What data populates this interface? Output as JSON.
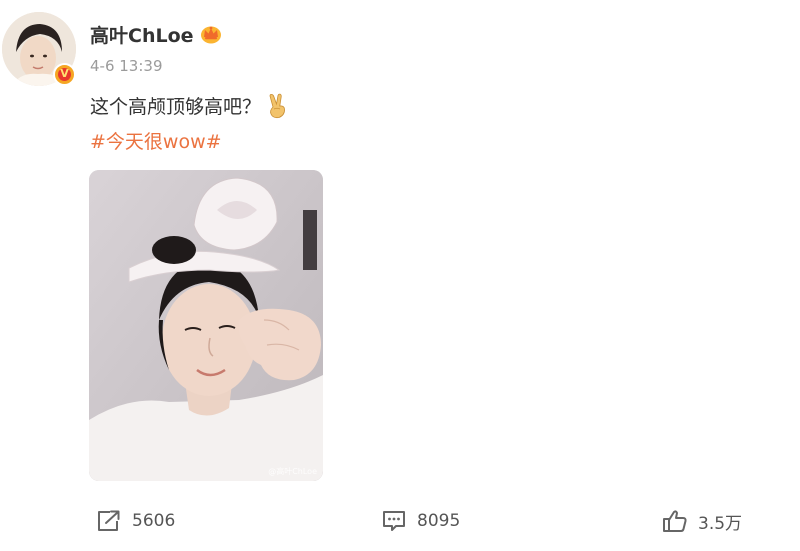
{
  "user": {
    "name": "高叶ChLoe",
    "verified_badge_glyph": "V",
    "member_icon": "crown-icon",
    "avatar_icon": "avatar-portrait"
  },
  "post": {
    "timestamp": "4-6 13:39",
    "text": "这个高颅顶够高吧？",
    "emoji_icon": "victory-hand-icon",
    "hashtag": "#今天很wow#",
    "photo": {
      "description_icon": "selfie-photo",
      "watermark": "@高叶ChLoe"
    }
  },
  "actions": {
    "repost": {
      "icon": "repost-icon",
      "count": "5606"
    },
    "comment": {
      "icon": "comment-icon",
      "count": "8095"
    },
    "like": {
      "icon": "thumbs-up-icon",
      "count": "3.5万"
    }
  },
  "colors": {
    "hashtag": "#eb7340",
    "text": "#333333",
    "muted": "#9b9b9b",
    "badge_red": "#e8372c",
    "badge_gold": "#f5a623"
  }
}
